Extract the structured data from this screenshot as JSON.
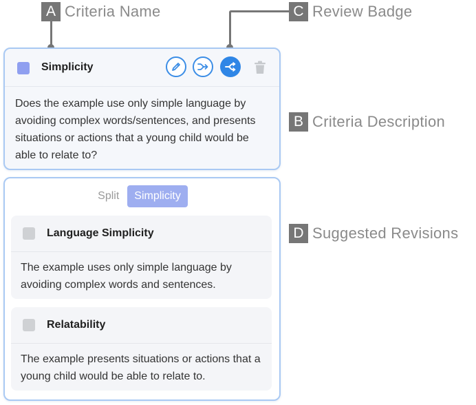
{
  "callouts": {
    "a": {
      "letter": "A",
      "text": "Criteria Name"
    },
    "b": {
      "letter": "B",
      "text": "Criteria Description"
    },
    "c": {
      "letter": "C",
      "text": "Review Badge"
    },
    "d": {
      "letter": "D",
      "text": "Suggested Revisions"
    }
  },
  "criteria": {
    "name": "Simplicity",
    "color": "#8f9ff0",
    "description": "Does the example use only simple language by avoiding complex words/sentences, and presents situations or actions that a young child would be able to relate to?",
    "actions": [
      "edit-icon",
      "merge-icon",
      "split-icon",
      "trash-icon"
    ]
  },
  "revisions": {
    "tabs": [
      {
        "label": "Split",
        "active": false
      },
      {
        "label": "Simplicity",
        "active": true
      }
    ],
    "items": [
      {
        "title": "Language Simplicity",
        "text": "The example uses only simple language by avoiding complex words and sentences."
      },
      {
        "title": "Relatability",
        "text": "The example presents situations or actions that a young child would be able to relate to."
      }
    ]
  }
}
